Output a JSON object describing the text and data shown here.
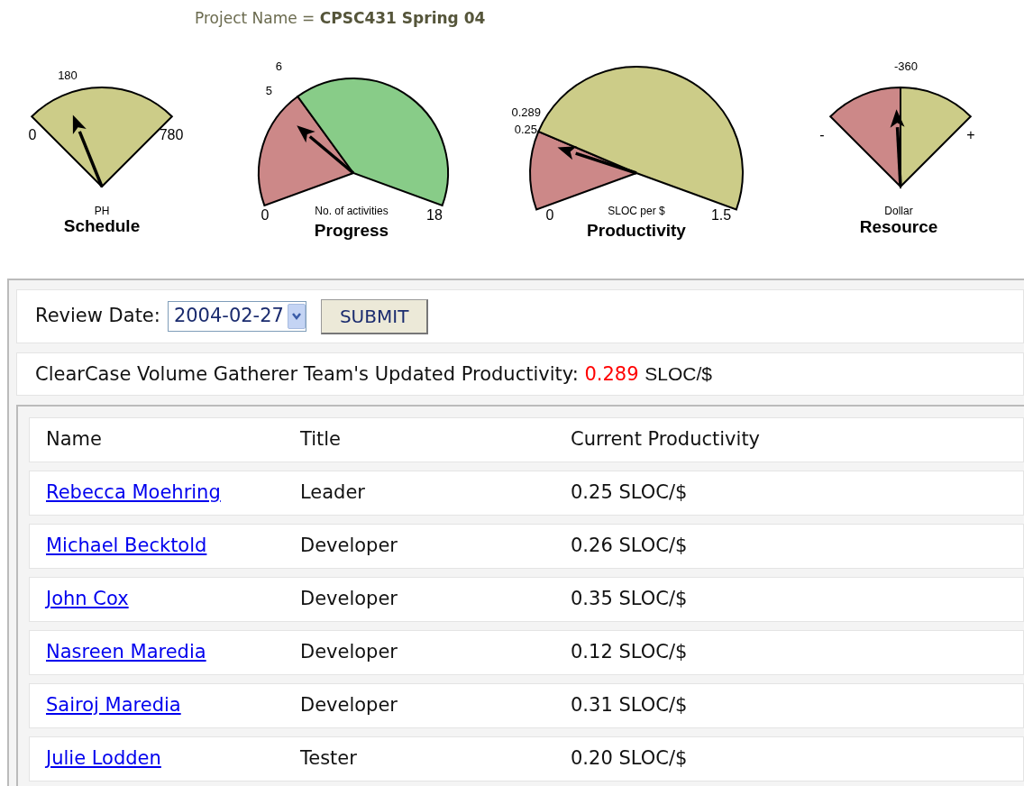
{
  "project_line": "Project Name = **CPSC431 Spring 04**",
  "gauges": [
    {
      "kind": "fan",
      "title": "Schedule",
      "unit": "PH",
      "min_label": "0",
      "max_label": "780",
      "zones": [
        {
          "color": "#cccc88"
        }
      ],
      "marks": [
        "180"
      ]
    },
    {
      "kind": "half",
      "title": "Progress",
      "unit": "No. of activities",
      "min_label": "0",
      "max_label": "18",
      "zones": [
        {
          "color": "#cc8888"
        },
        {
          "color": "#88cc88"
        }
      ],
      "marks": [
        "5",
        "6"
      ]
    },
    {
      "kind": "half",
      "title": "Productivity",
      "unit": "SLOC per $",
      "min_label": "0",
      "max_label": "1.5",
      "zones": [
        {
          "color": "#cc8888"
        },
        {
          "color": "#cccc88"
        }
      ],
      "marks": [
        "0.289",
        "0.25"
      ]
    },
    {
      "kind": "fan",
      "title": "Resource",
      "unit": "Dollar",
      "min_label": "-",
      "max_label": "+",
      "zones": [
        {
          "color": "#cc8888"
        },
        {
          "color": "#cccc88"
        }
      ],
      "marks": [
        "-360"
      ]
    }
  ],
  "review": {
    "label": "Review Date:",
    "value": "2004-02-27",
    "button": "SUBMIT"
  },
  "headline": {
    "text": "ClearCase Volume Gatherer Team's Updated Productivity: ",
    "value": "0.289",
    "unit": "SLOC/$"
  },
  "table": {
    "columns": [
      "Name",
      "Title",
      "Current Productivity"
    ],
    "rows": [
      {
        "name": "Rebecca Moehring",
        "title": "Leader",
        "productivity": "0.25 SLOC/$"
      },
      {
        "name": "Michael Becktold",
        "title": "Developer",
        "productivity": "0.26 SLOC/$"
      },
      {
        "name": "John Cox",
        "title": "Developer",
        "productivity": "0.35 SLOC/$"
      },
      {
        "name": "Nasreen Maredia",
        "title": "Developer",
        "productivity": "0.12 SLOC/$"
      },
      {
        "name": "Sairoj Maredia",
        "title": "Developer",
        "productivity": "0.31 SLOC/$"
      },
      {
        "name": "Julie Lodden",
        "title": "Tester",
        "productivity": "0.20 SLOC/$"
      }
    ]
  }
}
